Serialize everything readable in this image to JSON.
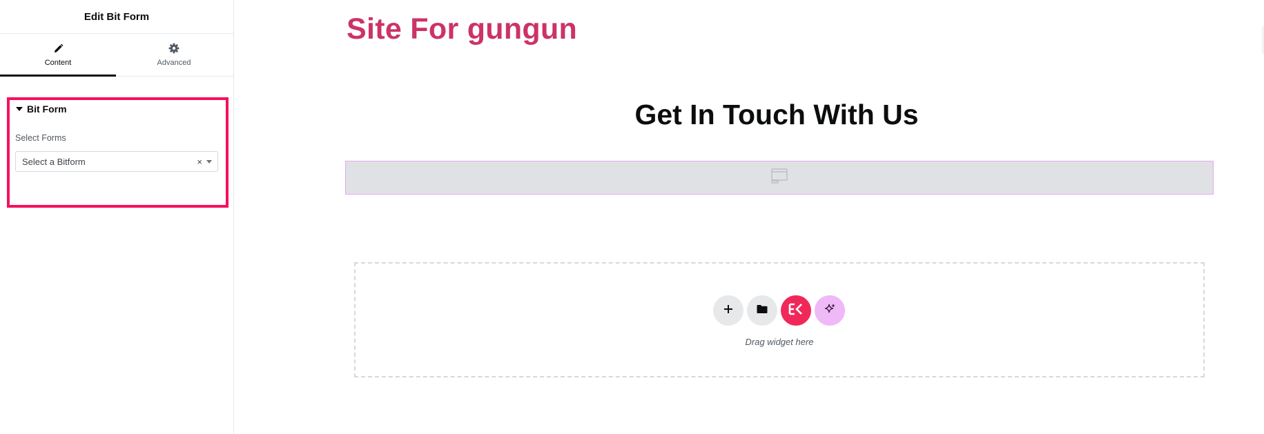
{
  "panel": {
    "title": "Edit Bit Form",
    "tabs": [
      {
        "label": "Content",
        "icon": "pencil-icon",
        "active": true
      },
      {
        "label": "Advanced",
        "icon": "gear-icon",
        "active": false
      }
    ],
    "section": {
      "title": "Bit Form",
      "control_label": "Select Forms",
      "select_placeholder": "Select a Bitform",
      "clear_symbol": "×"
    }
  },
  "canvas": {
    "site_title": "Site For gungun",
    "heading": "Get In Touch With Us",
    "drop_zone": {
      "buttons": [
        {
          "name": "add-section",
          "icon": "plus-icon"
        },
        {
          "name": "templates",
          "icon": "folder-icon"
        },
        {
          "name": "elementskit",
          "icon": "ek-logo-icon"
        },
        {
          "name": "ai",
          "icon": "sparkle-icon"
        }
      ],
      "text": "Drag widget here"
    }
  },
  "colors": {
    "highlight_border": "#f5115c",
    "site_title": "#cc3366",
    "ek_button": "#f0285a",
    "ai_button": "#efb8f7",
    "placeholder_bg": "#e0e1e4",
    "placeholder_border": "#e6a8f2"
  }
}
